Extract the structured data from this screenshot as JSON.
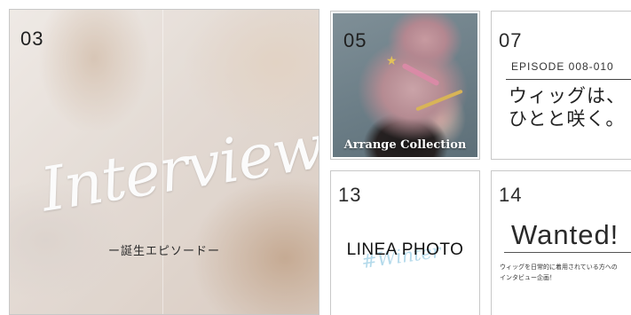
{
  "tiles": {
    "t03": {
      "number": "03",
      "script_title": "Interview",
      "subtitle": "ー誕生エピソードー"
    },
    "t05": {
      "number": "05",
      "caption": "Arrange Collection",
      "star_glyph": "★"
    },
    "t07": {
      "number": "07",
      "episode": "EPISODE 008-010",
      "headline_line1": "ウィッグは、",
      "headline_line2": "ひとと咲く。"
    },
    "t13": {
      "number": "13",
      "title": "LINEA PHOTO",
      "overlay": "#Winter"
    },
    "t14": {
      "number": "14",
      "title": "Wanted!",
      "body_line1": "ウィッグを日常的に着用されている方への",
      "body_line2": "インタビュー企画！"
    }
  },
  "colors": {
    "winter_accent": "#a8d4e8",
    "border": "#c8c8c8",
    "text_dark": "#222222"
  }
}
